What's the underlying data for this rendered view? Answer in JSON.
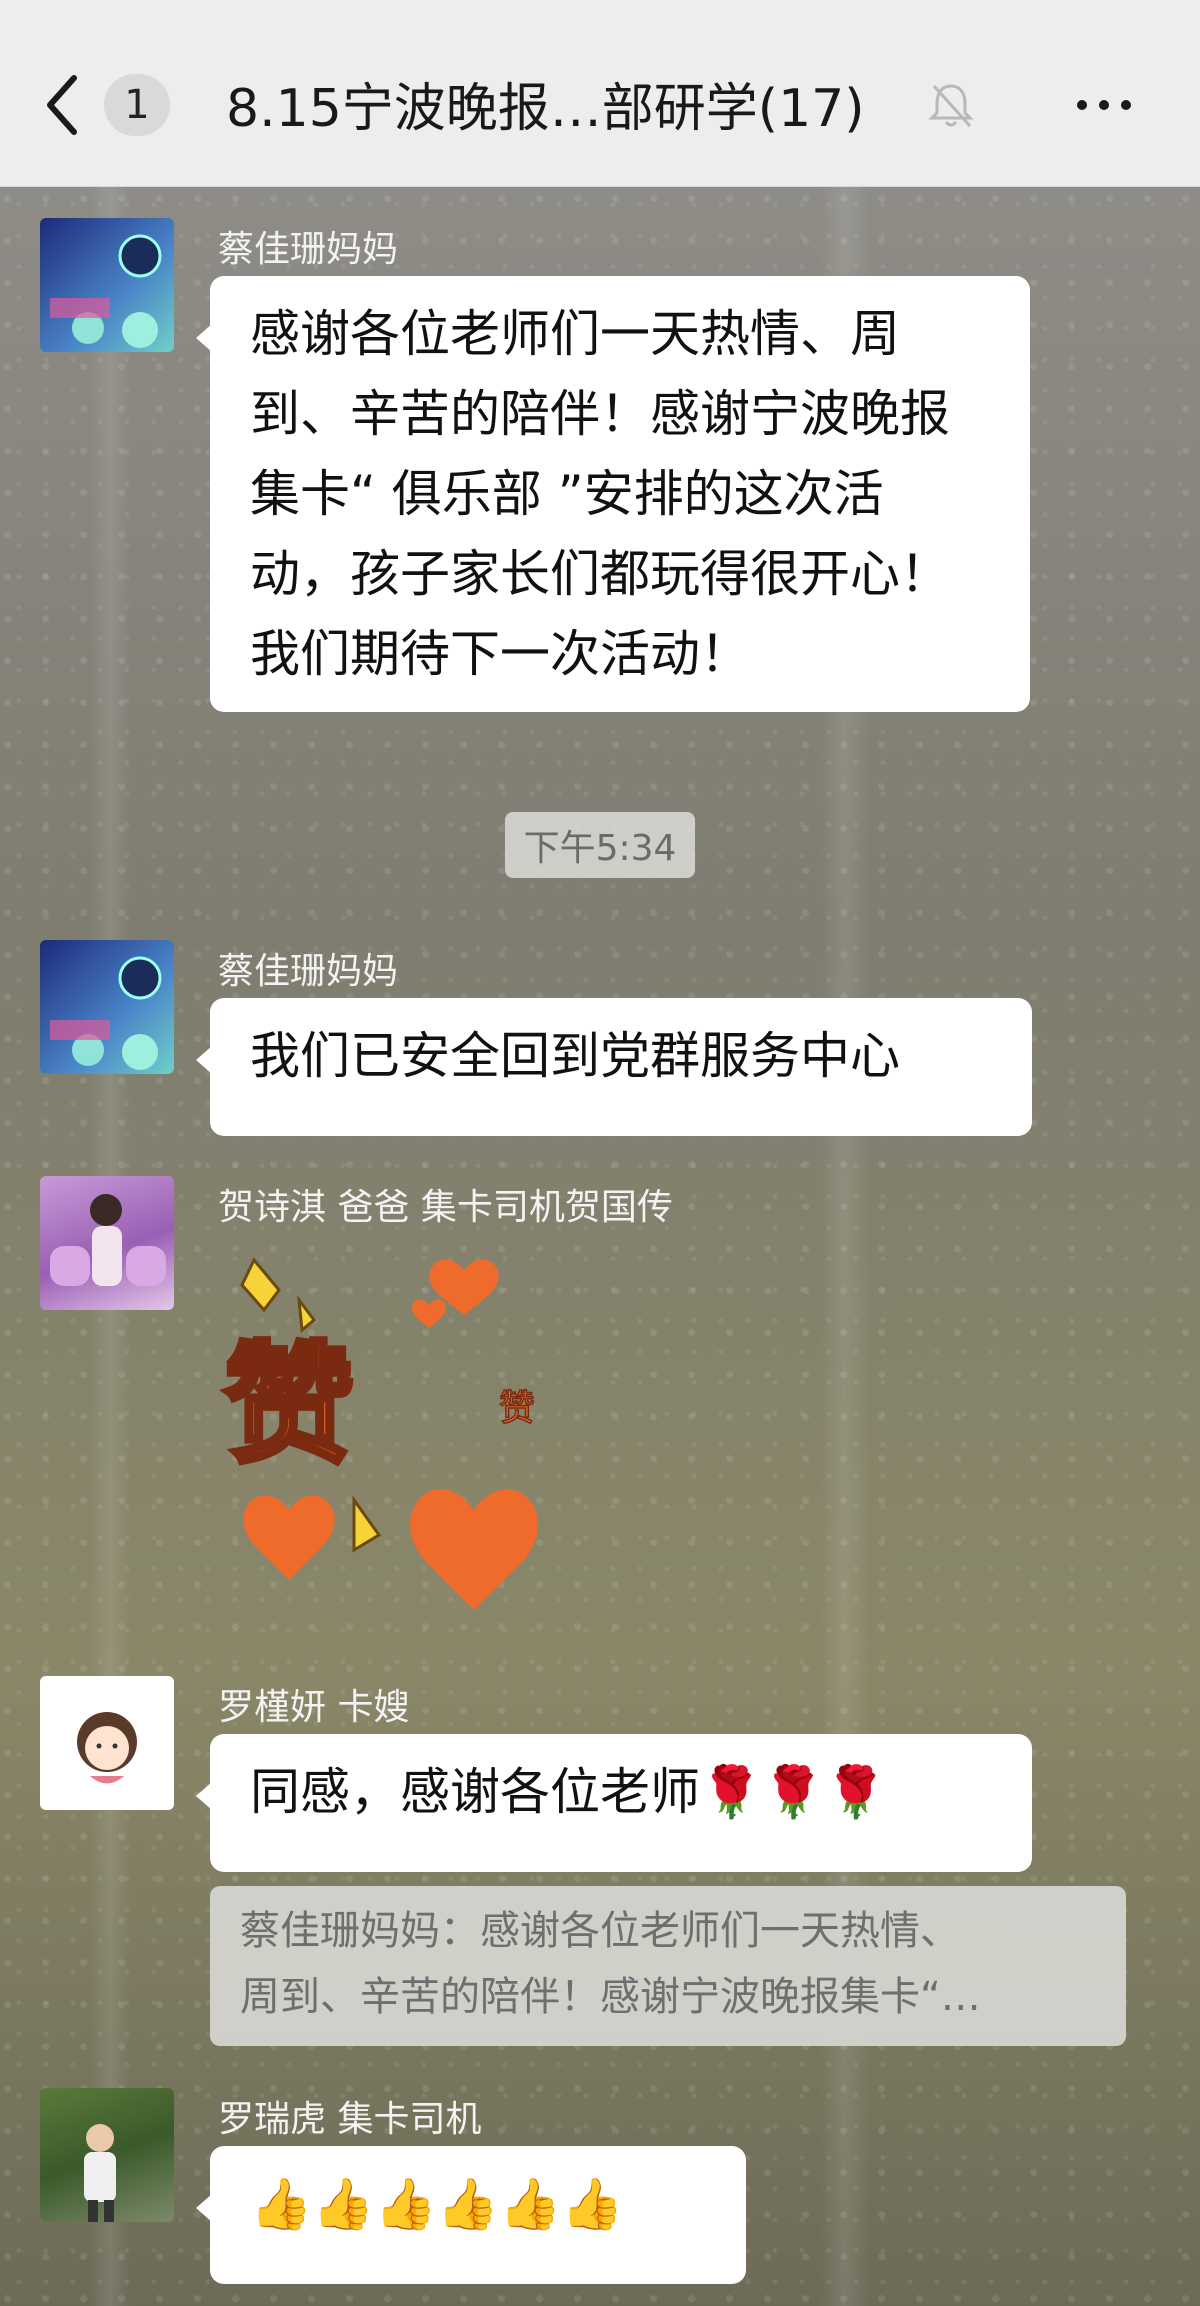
{
  "header": {
    "back_label": "<",
    "unread_count": "1",
    "title": "8.15宁波晚报…部研学(17)"
  },
  "messages": [
    {
      "sender": "蔡佳珊妈妈",
      "lines": [
        "感谢各位老师们一天热情、周",
        "到、辛苦的陪伴！感谢宁波晚报",
        "集卡“ 俱乐部 ”安排的这次活",
        "动，孩子家长们都玩得很开心！",
        "我们期待下一次活动！"
      ]
    },
    {
      "time": "下午5:34"
    },
    {
      "sender": "蔡佳珊妈妈",
      "text": "我们已安全回到党群服务中心"
    },
    {
      "sender": "贺诗淇 爸爸 集卡司机贺国传",
      "sticker": "赞"
    },
    {
      "sender": "罗槿妍 卡嫂",
      "text": "同感，感谢各位老师🌹🌹🌹",
      "quote": [
        "蔡佳珊妈妈：感谢各位老师们一天热情、",
        "周到、辛苦的陪伴！感谢宁波晚报集卡“…"
      ]
    },
    {
      "sender": "罗瑞虎 集卡司机",
      "text": "👍👍👍👍👍👍"
    }
  ]
}
